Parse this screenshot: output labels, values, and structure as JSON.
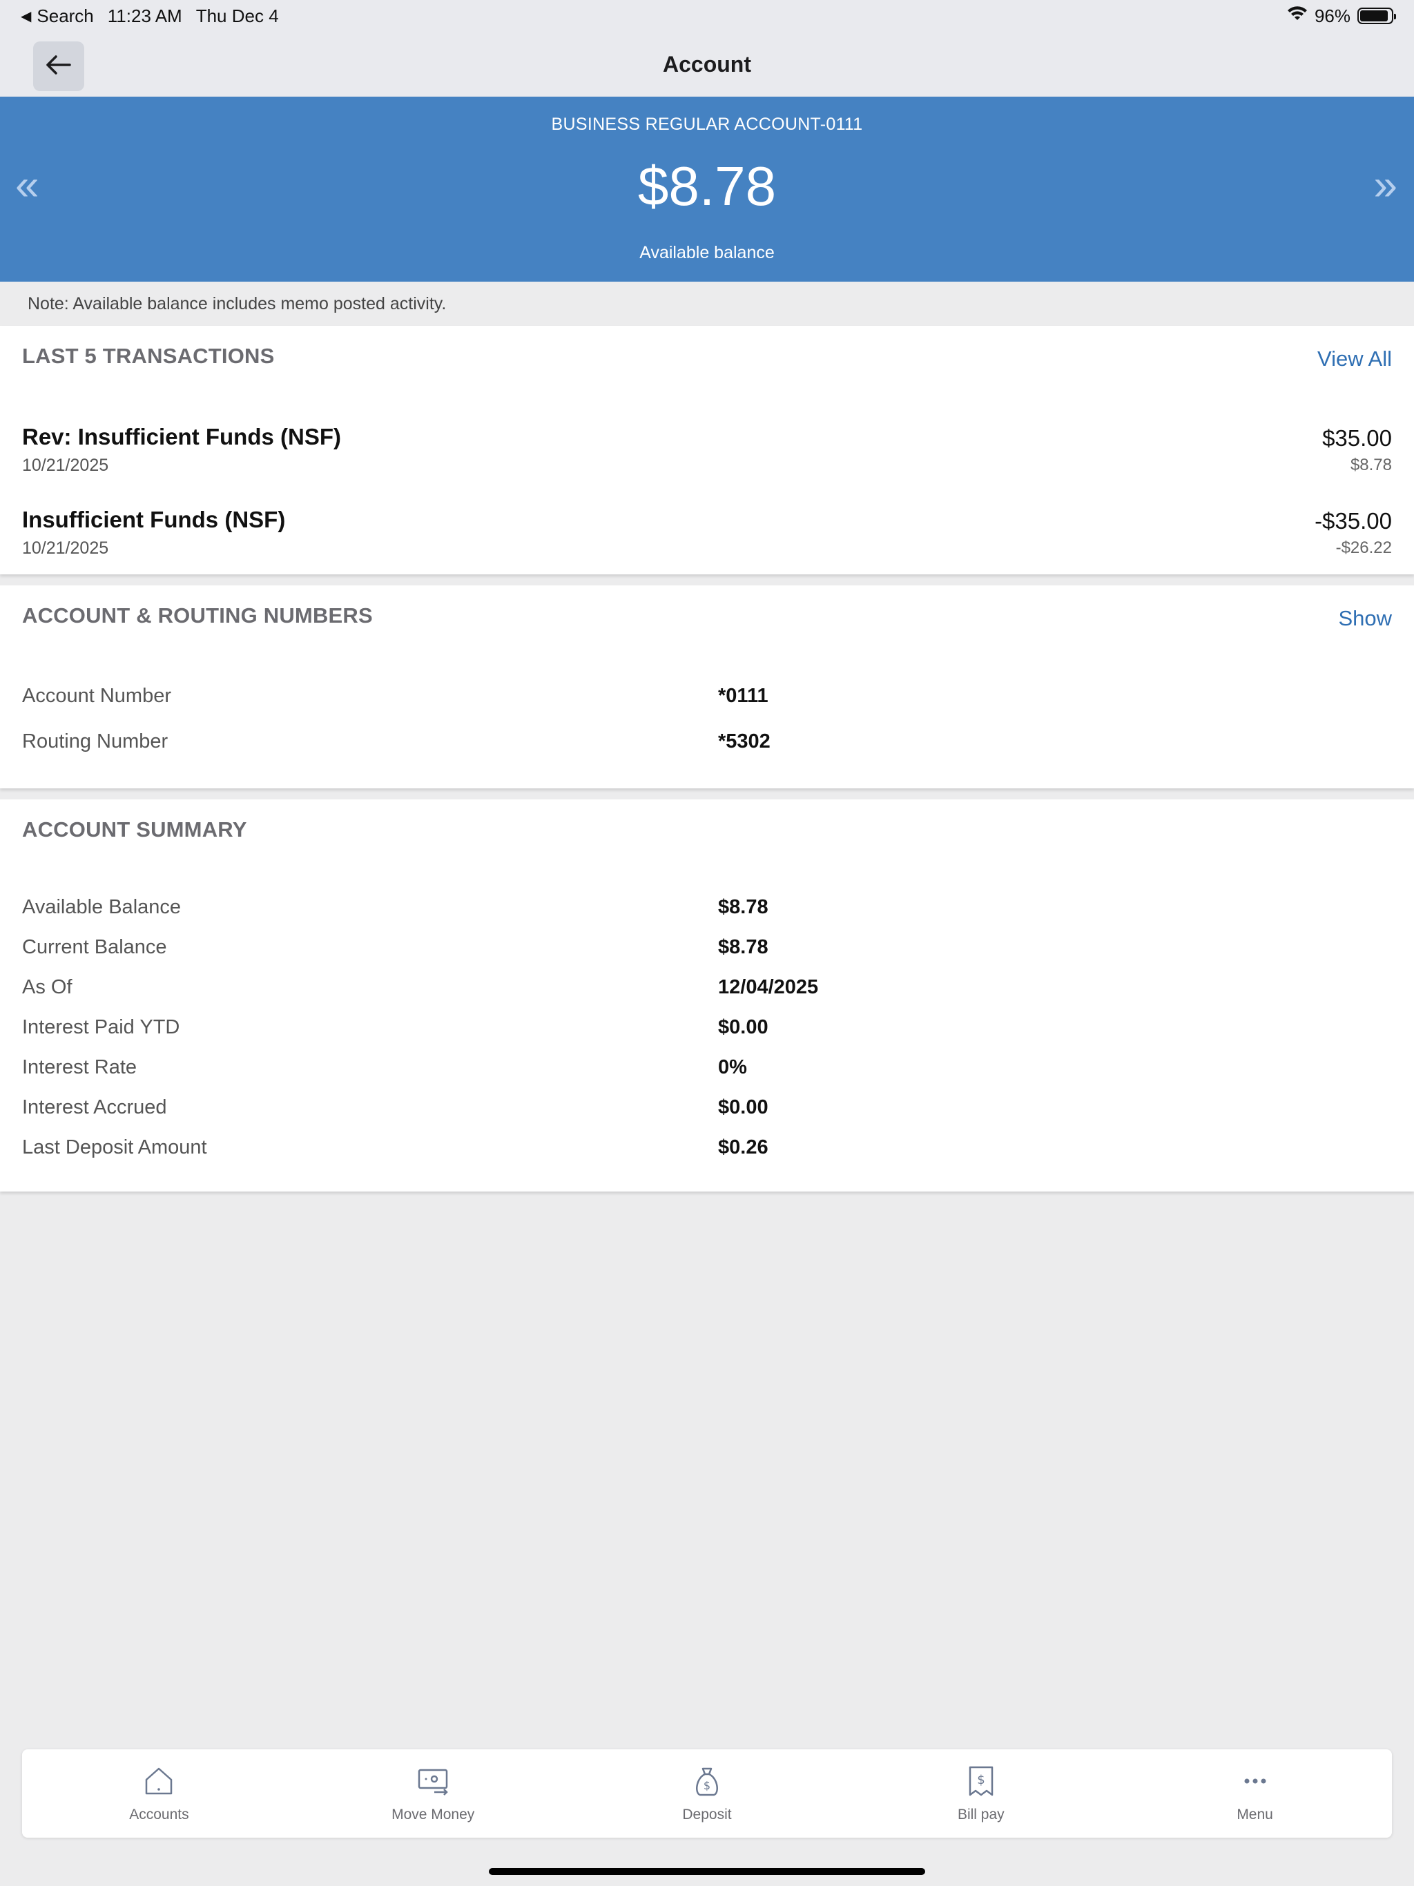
{
  "status_bar": {
    "back_app": "Search",
    "time": "11:23 AM",
    "date": "Thu Dec 4",
    "battery": "96%"
  },
  "header": {
    "title": "Account"
  },
  "banner": {
    "account_name": "BUSINESS REGULAR ACCOUNT-0111",
    "balance": "$8.78",
    "balance_label": "Available balance",
    "prev_glyph": "«",
    "next_glyph": "»"
  },
  "note": "Note: Available balance includes memo posted activity.",
  "transactions": {
    "title": "LAST 5 TRANSACTIONS",
    "view_all": "View All",
    "items": [
      {
        "description": "Rev: Insufficient Funds (NSF)",
        "date": "10/21/2025",
        "amount": "$35.00",
        "balance": "$8.78"
      },
      {
        "description": "Insufficient Funds (NSF)",
        "date": "10/21/2025",
        "amount": "-$35.00",
        "balance": "-$26.22"
      }
    ]
  },
  "routing": {
    "title": "ACCOUNT & ROUTING NUMBERS",
    "show": "Show",
    "rows": [
      {
        "label": "Account Number",
        "value": "*0111"
      },
      {
        "label": "Routing Number",
        "value": "*5302"
      }
    ]
  },
  "summary": {
    "title": "ACCOUNT SUMMARY",
    "rows": [
      {
        "label": "Available Balance",
        "value": "$8.78"
      },
      {
        "label": "Current Balance",
        "value": "$8.78"
      },
      {
        "label": "As Of",
        "value": "12/04/2025"
      },
      {
        "label": "Interest Paid YTD",
        "value": "$0.00"
      },
      {
        "label": "Interest Rate",
        "value": "0%"
      },
      {
        "label": "Interest Accrued",
        "value": "$0.00"
      },
      {
        "label": "Last Deposit Amount",
        "value": "$0.26"
      }
    ]
  },
  "tabs": [
    {
      "label": "Accounts",
      "icon": "home-icon"
    },
    {
      "label": "Move Money",
      "icon": "transfer-icon"
    },
    {
      "label": "Deposit",
      "icon": "money-bag-icon"
    },
    {
      "label": "Bill pay",
      "icon": "bill-icon"
    },
    {
      "label": "Menu",
      "icon": "more-icon"
    }
  ],
  "colors": {
    "banner": "#4582c2",
    "link": "#2f6fb3",
    "background": "#ececed"
  }
}
